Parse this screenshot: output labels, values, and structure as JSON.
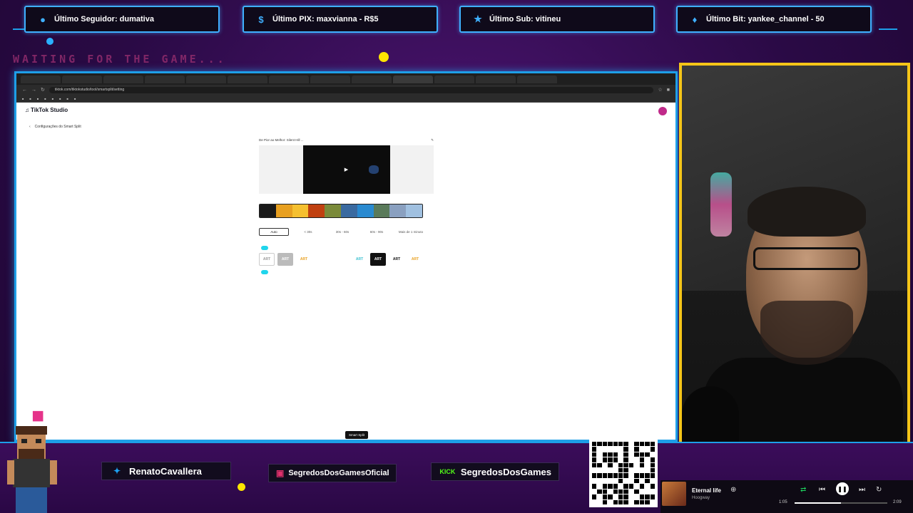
{
  "alerts": [
    {
      "icon": "user-icon",
      "text": "Último Seguidor: dumativa"
    },
    {
      "icon": "dollar-icon",
      "text": "Último PIX: maxvianna - R$5"
    },
    {
      "icon": "star-icon",
      "text": "Último Sub: vitineu"
    },
    {
      "icon": "diamond-icon",
      "text": "Último Bit: yankee_channel - 50"
    }
  ],
  "waiting_text": "WAITING FOR THE GAME...",
  "browser": {
    "url": "tiktok.com/tiktokstudio/tool/smartsplit/setting",
    "tiktok_logo": "TikTok Studio",
    "back_label": "Configurações do Smart Split",
    "video_title": "De Pior ao Melhor: Silent Hill ...",
    "duration_options": [
      "Auto",
      "< 30s",
      "30s - 60s",
      "60s - 90s",
      "Mais de 1 minuto"
    ],
    "caption_styles": [
      "ART",
      "ART",
      "ART",
      "",
      "",
      "ART",
      "ART",
      "ART",
      "ART"
    ],
    "submit_label": "Smart Split"
  },
  "social": {
    "twitter": "RenatoCavallera",
    "instagram": "SegredosDosGamesOficial",
    "kick_badge": "KICK",
    "kick": "SegredosDosGames"
  },
  "livepix_url": "livepix.gg/segredosdosgames",
  "player": {
    "song": "Eternal life",
    "artist": "Hoogway",
    "time_current": "1:05",
    "time_total": "2:09",
    "progress_fraction": 0.5
  },
  "colors": {
    "accent_blue": "#1e9fe8",
    "webcam_border": "#f5c518",
    "background": "#2a0a45"
  }
}
